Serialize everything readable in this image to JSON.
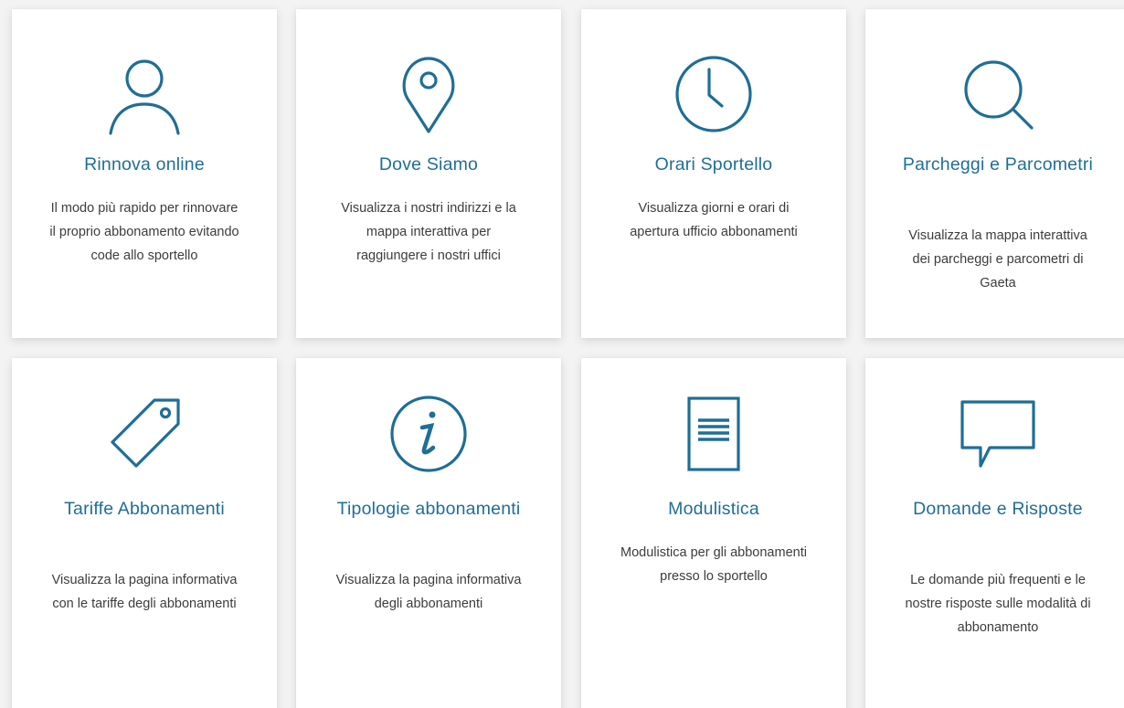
{
  "cards": [
    {
      "title": "Rinnova online",
      "description": "Il modo più rapido per rinnovare il proprio abbonamento evitando code allo sportello",
      "icon": "user-icon"
    },
    {
      "title": "Dove Siamo",
      "description": "Visualizza i nostri indirizzi e la mappa interattiva per raggiungere i nostri uffici",
      "icon": "map-pin-icon"
    },
    {
      "title": "Orari Sportello",
      "description": "Visualizza giorni e orari di apertura ufficio abbonamenti",
      "icon": "clock-icon"
    },
    {
      "title": "Parcheggi e Parcometri",
      "description": "Visualizza la mappa interattiva dei parcheggi e parcometri di Gaeta",
      "icon": "search-icon"
    },
    {
      "title": "Tariffe Abbonamenti",
      "description": "Visualizza la pagina informativa con le tariffe degli abbonamenti",
      "icon": "tag-icon"
    },
    {
      "title": "Tipologie abbonamenti",
      "description": "Visualizza la pagina informativa degli abbonamenti",
      "icon": "info-icon"
    },
    {
      "title": "Modulistica",
      "description": "Modulistica per gli abbonamenti presso lo sportello",
      "icon": "document-icon"
    },
    {
      "title": "Domande e Risposte",
      "description": "Le domande più frequenti e le nostre risposte sulle modalità di abbonamento",
      "icon": "speech-bubble-icon"
    }
  ],
  "colors": {
    "accent": "#1f6e96",
    "text": "#3c3c3c",
    "card_bg": "#ffffff",
    "page_bg": "#f3f3f3"
  }
}
